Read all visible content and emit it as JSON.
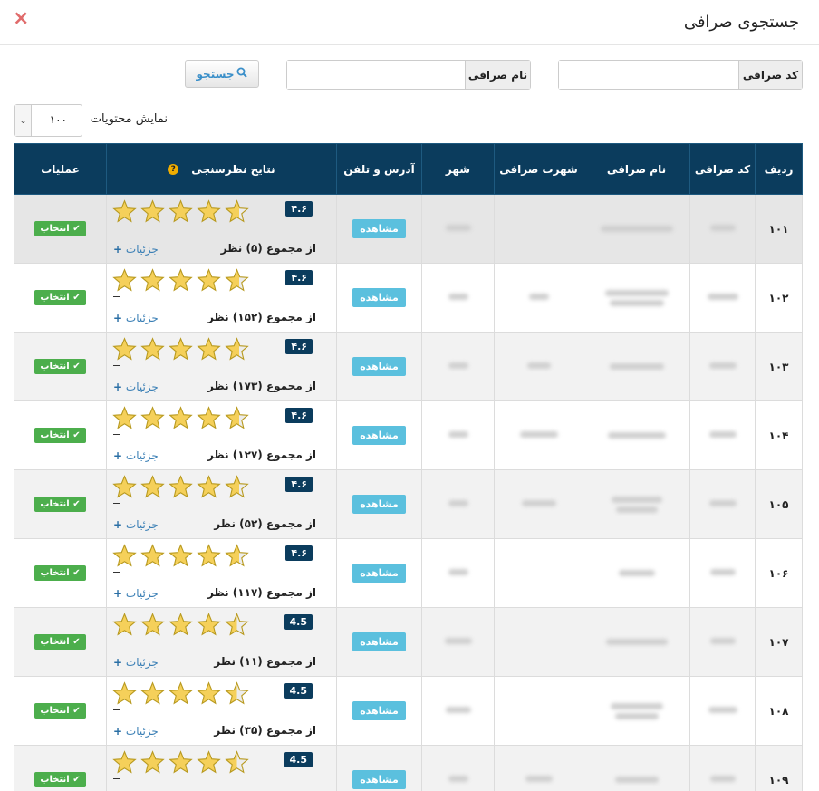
{
  "dialog": {
    "title": "جستجوی صرافی",
    "close_icon": "×"
  },
  "filters": {
    "code_label": "کد صرافی",
    "code_value": "",
    "name_label": "نام صرافی",
    "name_value": "",
    "search_label": "جستجو"
  },
  "page_size": {
    "label": "نمایش محتویات",
    "value": "۱۰۰"
  },
  "table": {
    "headers": {
      "row": "ردیف",
      "code": "کد صرافی",
      "name": "نام صرافی",
      "fame": "شهرت صرافی",
      "city": "شهر",
      "address": "آدرس و تلفن",
      "rating": "نتایج نظرسنجی",
      "actions": "عملیات"
    },
    "rows": [
      {
        "num": "۱۰۱",
        "score": "۴.۶",
        "score_value": 4.6,
        "total": "از مجموع  (۵) نظر",
        "view": "مشاهده",
        "select": "انتخاب",
        "details": "جزئیات"
      },
      {
        "num": "۱۰۲",
        "score": "۴.۶",
        "score_value": 4.6,
        "total": "از مجموع  (۱۵۲) نظر",
        "view": "مشاهده",
        "select": "انتخاب",
        "details": "جزئیات"
      },
      {
        "num": "۱۰۳",
        "score": "۴.۶",
        "score_value": 4.6,
        "total": "از مجموع  (۱۷۳) نظر",
        "view": "مشاهده",
        "select": "انتخاب",
        "details": "جزئیات"
      },
      {
        "num": "۱۰۴",
        "score": "۴.۶",
        "score_value": 4.6,
        "total": "از مجموع  (۱۲۷) نظر",
        "view": "مشاهده",
        "select": "انتخاب",
        "details": "جزئیات"
      },
      {
        "num": "۱۰۵",
        "score": "۴.۶",
        "score_value": 4.6,
        "total": "از مجموع  (۵۲) نظر",
        "view": "مشاهده",
        "select": "انتخاب",
        "details": "جزئیات"
      },
      {
        "num": "۱۰۶",
        "score": "۴.۶",
        "score_value": 4.6,
        "total": "از مجموع  (۱۱۷) نظر",
        "view": "مشاهده",
        "select": "انتخاب",
        "details": "جزئیات"
      },
      {
        "num": "۱۰۷",
        "score": "4.5",
        "score_value": 4.5,
        "total": "از مجموع  (۱۱) نظر",
        "view": "مشاهده",
        "select": "انتخاب",
        "details": "جزئیات"
      },
      {
        "num": "۱۰۸",
        "score": "4.5",
        "score_value": 4.5,
        "total": "از مجموع  (۳۵) نظر",
        "view": "مشاهده",
        "select": "انتخاب",
        "details": "جزئیات"
      },
      {
        "num": "۱۰۹",
        "score": "4.5",
        "score_value": 4.5,
        "total": "",
        "view": "مشاهده",
        "select": "انتخاب",
        "details": ""
      }
    ]
  },
  "colors": {
    "header_bg": "#0b3c5d",
    "view_btn": "#5bc0de",
    "select_btn": "#4cae4c",
    "star_fill": "#f5d05a",
    "star_stroke": "#b89a20",
    "close": "#e06b6b"
  }
}
